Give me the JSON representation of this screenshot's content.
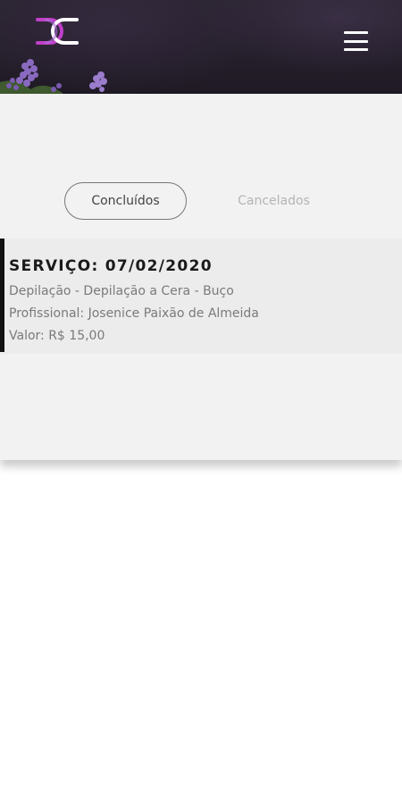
{
  "header": {
    "logo_icon": "dc-monogram-logo-icon",
    "menu_icon": "hamburger-menu-icon",
    "logo_colors": [
      "#c040c8",
      "#ffffff"
    ]
  },
  "tabs": [
    {
      "label": "Concluídos",
      "active": true
    },
    {
      "label": "Cancelados",
      "active": false
    }
  ],
  "services": [
    {
      "title": "SERVIÇO: 07/02/2020",
      "description": "Depilação - Depilação a Cera - Buço",
      "professional": "Profissional: Josenice Paixão de Almeida",
      "value": "Valor: R$ 15,00"
    }
  ],
  "colors": {
    "header_bg": "#241e2a",
    "panel_bg": "#f2f2f2",
    "card_bg": "#ececec",
    "accent_bar": "#111111",
    "inactive_tab": "#b4b4b4"
  }
}
